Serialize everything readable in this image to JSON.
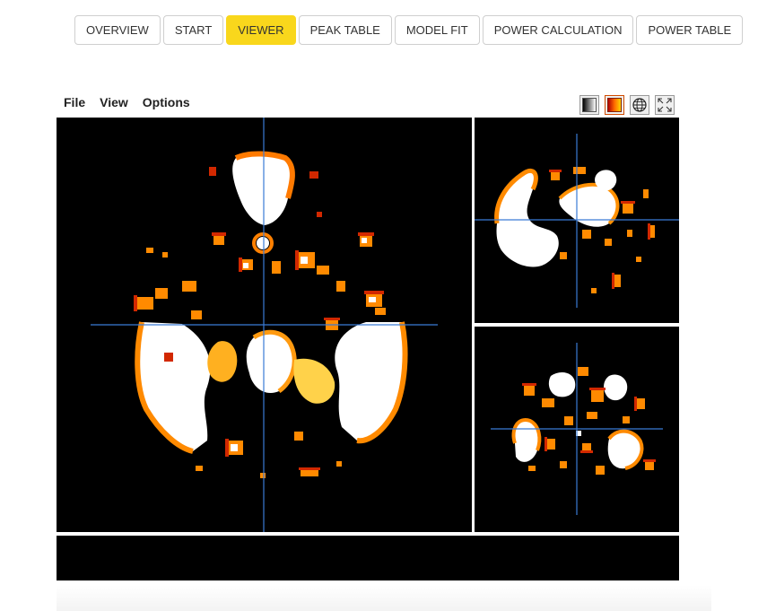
{
  "tabs": [
    {
      "label": "OVERVIEW",
      "active": false
    },
    {
      "label": "START",
      "active": false
    },
    {
      "label": "VIEWER",
      "active": true
    },
    {
      "label": "PEAK TABLE",
      "active": false
    },
    {
      "label": "MODEL FIT",
      "active": false
    },
    {
      "label": "POWER CALCULATION",
      "active": false
    },
    {
      "label": "POWER TABLE",
      "active": false
    }
  ],
  "menu": {
    "file": "File",
    "view": "View",
    "options": "Options"
  },
  "toolbar": {
    "buttons": [
      "grayscale-colormap-icon",
      "hot-colormap-icon",
      "globe-icon",
      "fullscreen-icon"
    ]
  },
  "viewer": {
    "colormap": "hot",
    "colors": {
      "background": "#000000",
      "crosshair": "#3a7bd5",
      "hot_low": "#c81e00",
      "hot_mid": "#ff8a00",
      "hot_high": "#ffffff"
    }
  }
}
